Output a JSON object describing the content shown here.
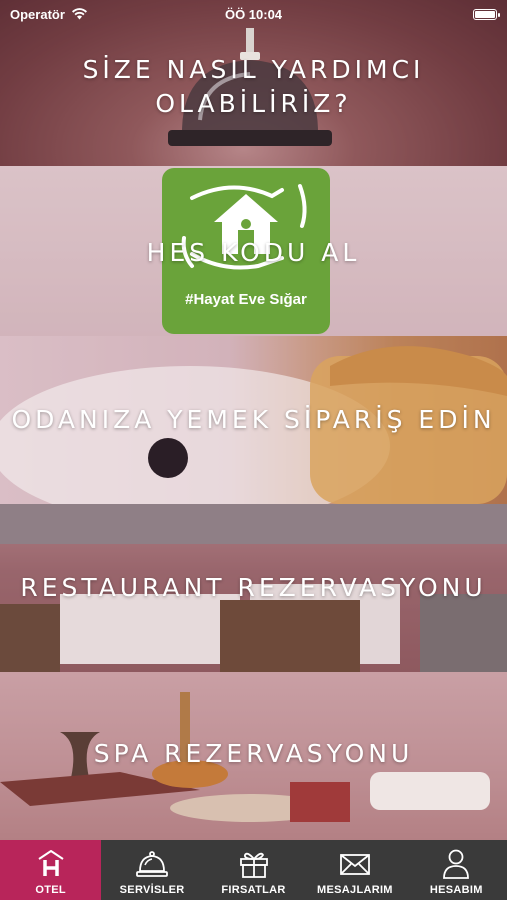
{
  "status_bar": {
    "carrier": "Operatör",
    "time": "ÖÖ 10:04"
  },
  "panels": [
    {
      "id": "help",
      "label": "SİZE NASIL YARDIMCI\nOLABİLİRİZ?"
    },
    {
      "id": "hes",
      "label": "HES KODU AL",
      "logo_tag": "#Hayat Eve Sığar",
      "logo_color": "#6aa33a"
    },
    {
      "id": "room-service",
      "label": "ODANIZA YEMEK SİPARİŞ EDİN"
    },
    {
      "id": "restaurant",
      "label": "RESTAURANT REZERVASYONU"
    },
    {
      "id": "spa",
      "label": "SPA REZERVASYONU"
    }
  ],
  "tabbar": {
    "active_color": "#b8255a",
    "background": "#3a3a3a",
    "tabs": [
      {
        "label": "OTEL",
        "icon": "hotel-icon",
        "active": true
      },
      {
        "label": "SERVİSLER",
        "icon": "bell-icon",
        "active": false
      },
      {
        "label": "FIRSATLAR",
        "icon": "gift-icon",
        "active": false
      },
      {
        "label": "MESAJLARIM",
        "icon": "envelope-icon",
        "active": false
      },
      {
        "label": "HESABIM",
        "icon": "user-icon",
        "active": false
      }
    ]
  }
}
